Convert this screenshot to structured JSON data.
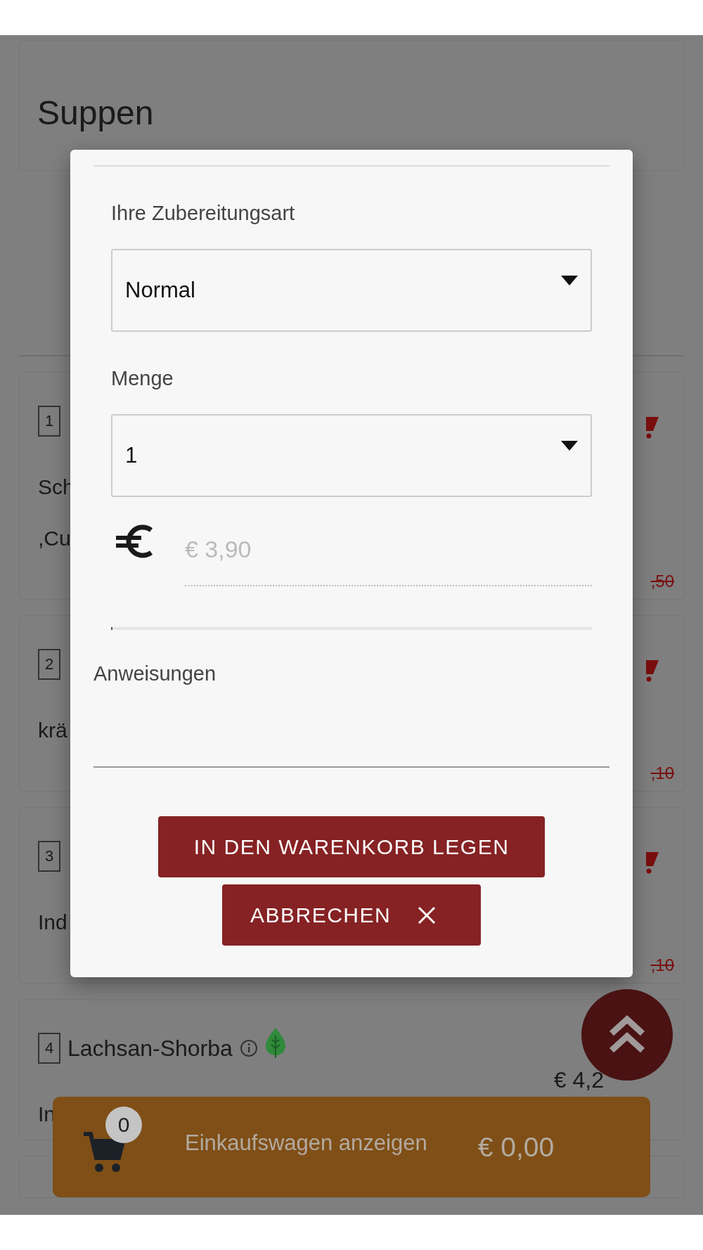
{
  "section_title": "Suppen",
  "dishes": [
    {
      "number": "1",
      "description": [
        "Sch",
        ",Cu"
      ],
      "old_price": ",50"
    },
    {
      "number": "2",
      "description": [
        "krä"
      ],
      "old_price": ",10"
    },
    {
      "number": "3",
      "description": [
        "Ind"
      ],
      "old_price": ",10"
    },
    {
      "number": "4",
      "title": "Lachsan-Shorba",
      "vegetarian": true,
      "price": "€ 4,2",
      "description": [
        "In"
      ]
    }
  ],
  "dialog": {
    "fields": [
      {
        "kind": "select",
        "label": "Ihre Zubereitungsart",
        "value": "Normal"
      },
      {
        "kind": "select",
        "label": "Menge",
        "value": "1"
      },
      {
        "kind": "price",
        "placeholder": "€ 3,90"
      },
      {
        "kind": "textarea",
        "label": "Anweisungen"
      }
    ],
    "buttons": [
      {
        "kind": "primary",
        "label": "IN DEN WARENKORB LEGEN"
      },
      {
        "kind": "cancel",
        "label": "ABBRECHEN"
      }
    ]
  },
  "cart_bar": {
    "count": "0",
    "label": "Einkaufswagen anzeigen",
    "total": "€ 0,00"
  }
}
